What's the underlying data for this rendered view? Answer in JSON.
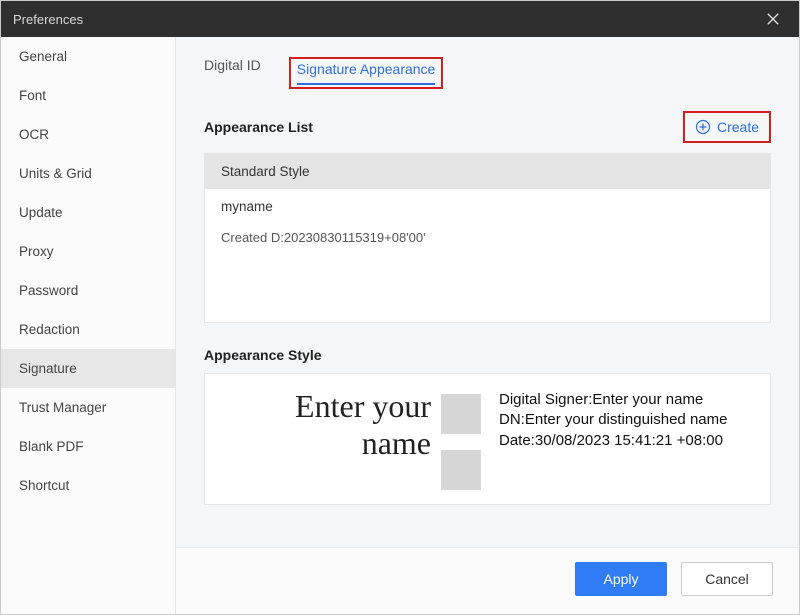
{
  "window": {
    "title": "Preferences"
  },
  "sidebar": {
    "items": [
      {
        "label": "General"
      },
      {
        "label": "Font"
      },
      {
        "label": "OCR"
      },
      {
        "label": "Units & Grid"
      },
      {
        "label": "Update"
      },
      {
        "label": "Proxy"
      },
      {
        "label": "Password"
      },
      {
        "label": "Redaction"
      },
      {
        "label": "Signature"
      },
      {
        "label": "Trust Manager"
      },
      {
        "label": "Blank PDF"
      },
      {
        "label": "Shortcut"
      }
    ],
    "active_index": 8
  },
  "tabs": {
    "items": [
      {
        "label": "Digital ID"
      },
      {
        "label": "Signature Appearance"
      }
    ],
    "active_index": 1
  },
  "appearance_list": {
    "heading": "Appearance List",
    "create_label": "Create",
    "standard_label": "Standard Style",
    "entry_name": "myname",
    "entry_detail": "Created D:20230830115319+08'00'"
  },
  "appearance_style": {
    "heading": "Appearance Style",
    "preview_name_line1": "Enter your",
    "preview_name_line2": "name",
    "details": {
      "signer_label": "Digital Signer:",
      "signer_value": "Enter your name",
      "dn_label": "DN:",
      "dn_value": "Enter your distinguished name",
      "date_label": "Date:",
      "date_value": "30/08/2023 15:41:21 +08:00"
    }
  },
  "footer": {
    "apply": "Apply",
    "cancel": "Cancel"
  }
}
